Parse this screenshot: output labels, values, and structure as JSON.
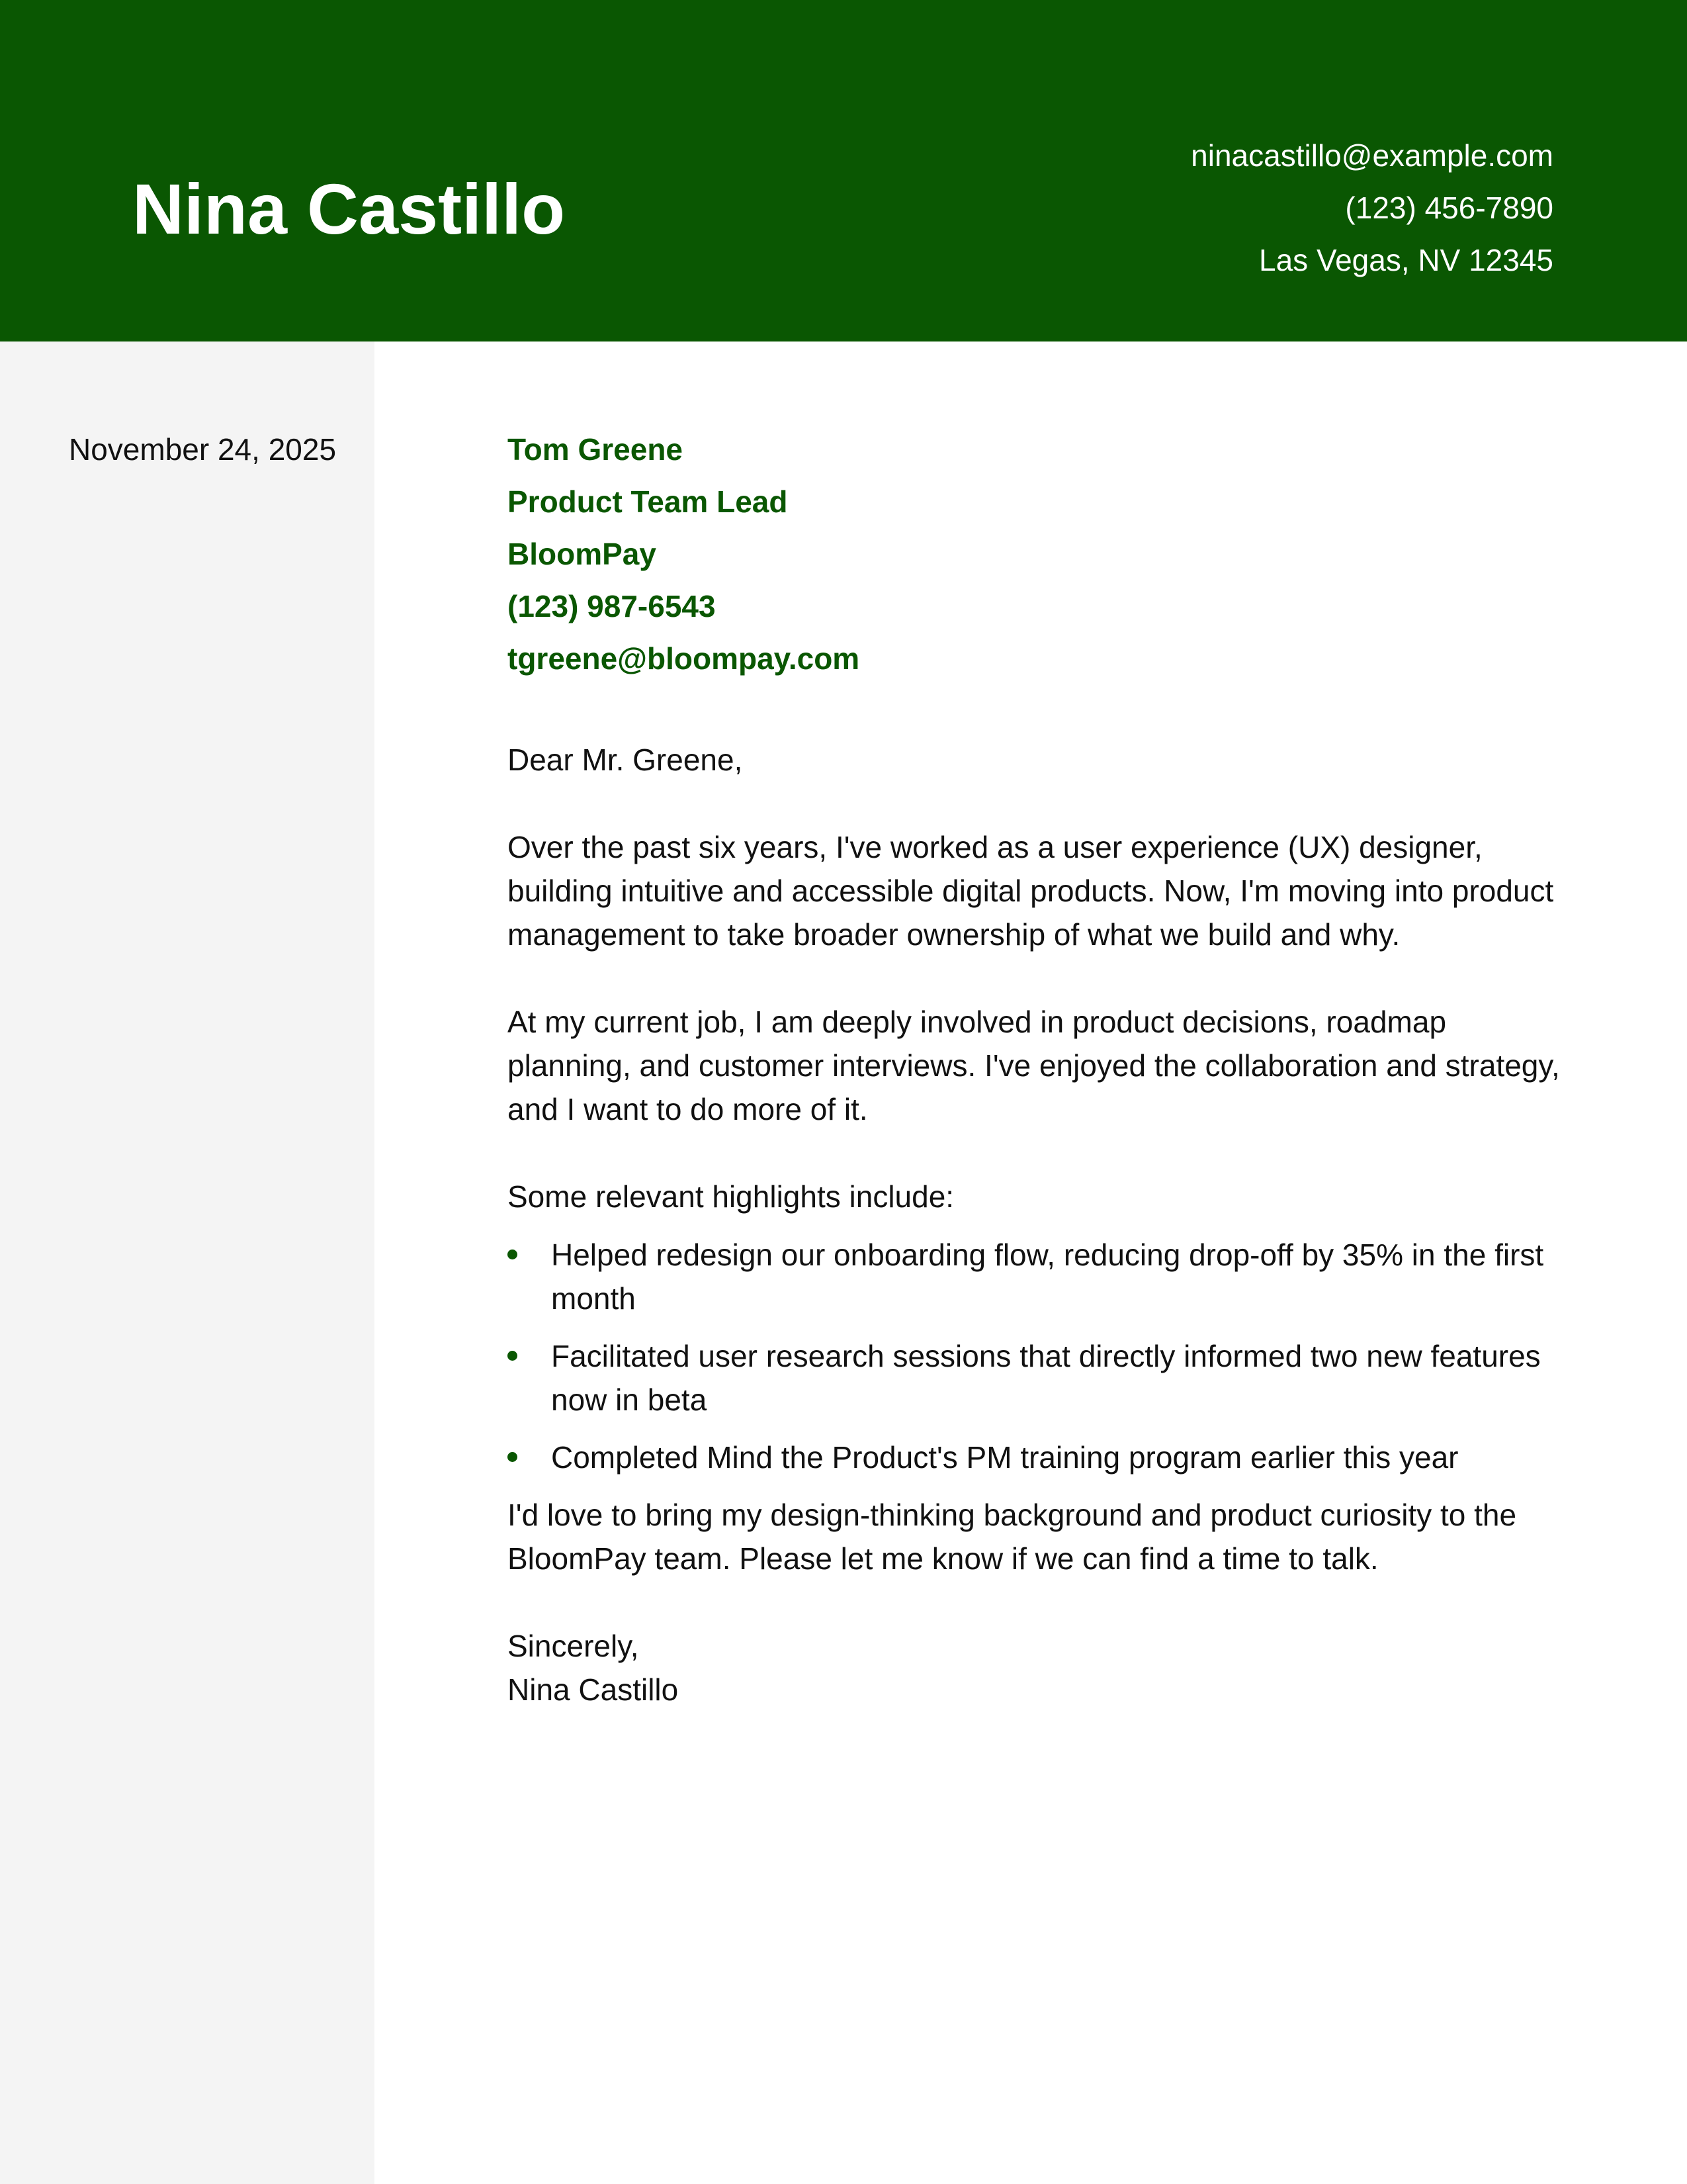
{
  "header": {
    "name": "Nina Castillo",
    "email": "ninacastillo@example.com",
    "phone": "(123) 456-7890",
    "location": "Las Vegas, NV 12345"
  },
  "sidebar": {
    "date": "November 24, 2025"
  },
  "recipient": {
    "name": "Tom Greene",
    "title": "Product Team Lead",
    "company": "BloomPay",
    "phone": "(123) 987-6543",
    "email": "tgreene@bloompay.com"
  },
  "letter": {
    "salutation": "Dear Mr. Greene,",
    "paragraph_1": "Over the past six years, I've worked as a user experience (UX) designer, building intuitive and accessible digital products. Now, I'm moving into product management to take broader ownership of what we build and why.",
    "paragraph_2": "At my current job, I am deeply involved in product decisions, roadmap planning, and customer interviews. I've enjoyed the collaboration and strategy, and I want to do more of it.",
    "highlights_intro": "Some relevant highlights include:",
    "highlights": [
      "Helped redesign our onboarding flow, reducing drop-off by 35% in the first month",
      "Facilitated user research sessions that directly informed two new features now in beta",
      "Completed Mind the Product's PM training program earlier this year"
    ],
    "paragraph_3": "I'd love to bring my design-thinking background and product curiosity to the BloomPay team. Please let me know if we can find a time to talk.",
    "closing": "Sincerely,",
    "signature": "Nina Castillo"
  },
  "colors": {
    "accent": "#0a5702",
    "sidebar_bg": "#f4f4f4",
    "text": "#111111"
  }
}
